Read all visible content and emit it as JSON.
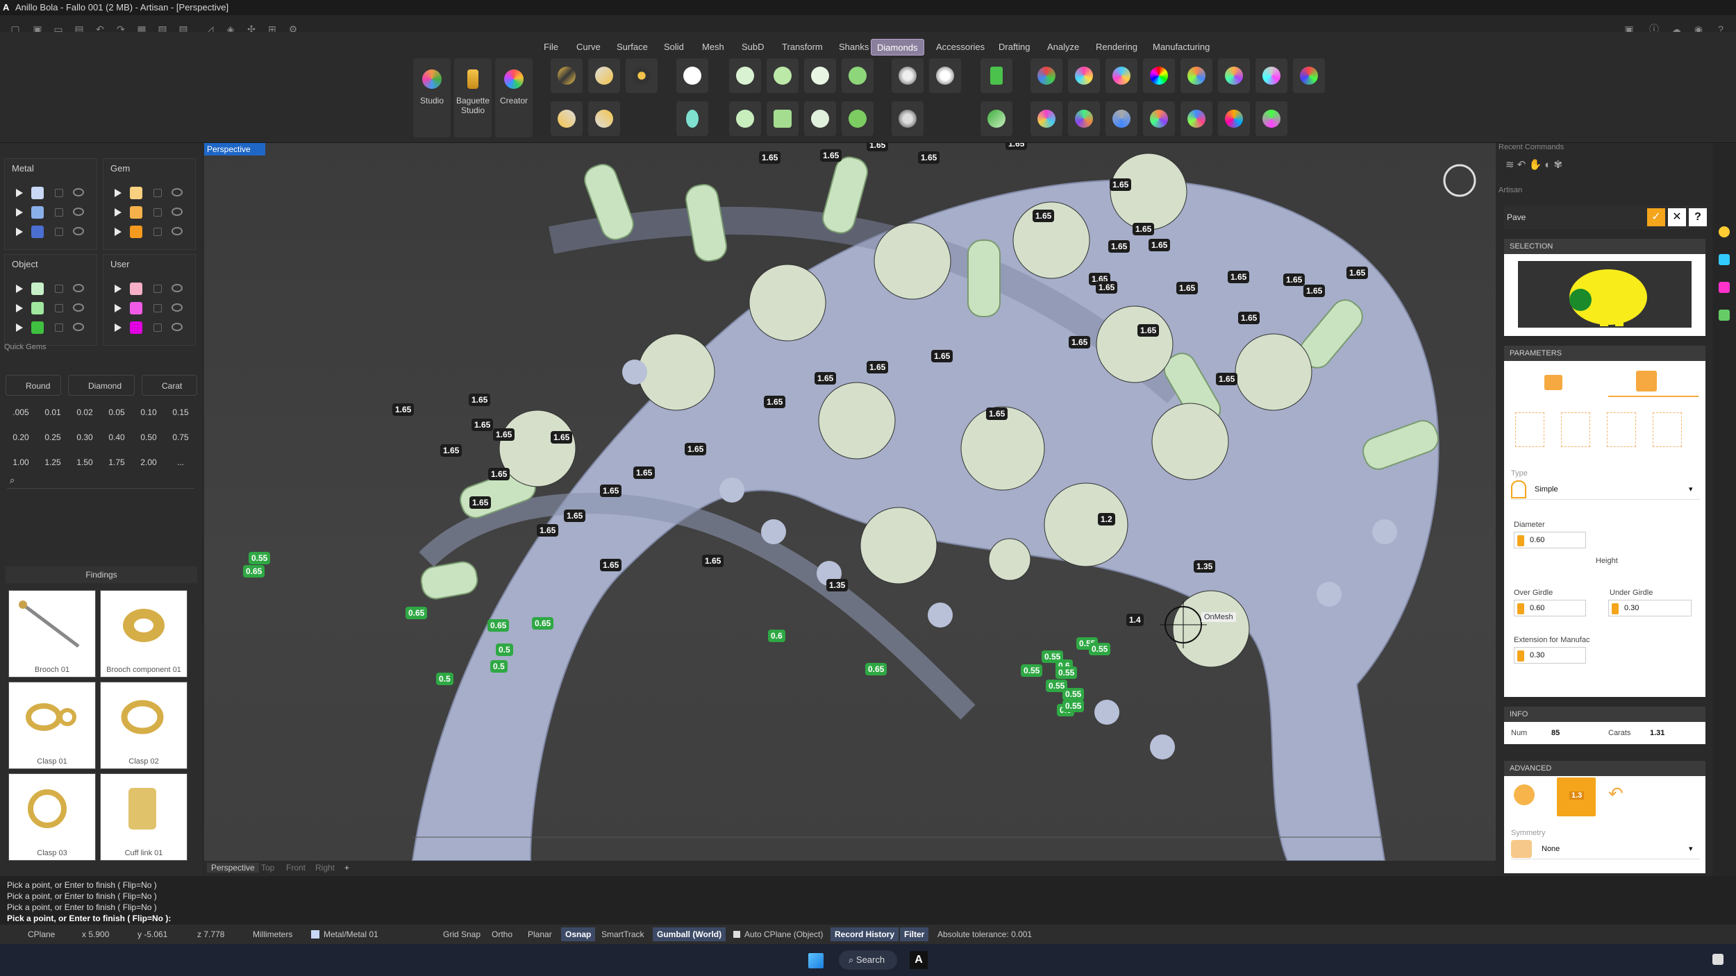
{
  "window": {
    "title": "Anillo Bola - Fallo 001 (2 MB) - Artisan - [Perspective]"
  },
  "menus": [
    "File",
    "Curve",
    "Surface",
    "Solid",
    "Mesh",
    "SubD",
    "Transform",
    "Shanks",
    "Diamonds",
    "Accessories",
    "Drafting",
    "Analyze",
    "Rendering",
    "Manufacturing"
  ],
  "active_menu": "Diamonds",
  "big_tools": [
    {
      "label": "Studio"
    },
    {
      "label": "Baguette Studio"
    },
    {
      "label": "Creator"
    }
  ],
  "layers": {
    "metal": {
      "title": "Metal",
      "colors": [
        "#c8d7f5",
        "#8ab0ea",
        "#4a6fd1"
      ]
    },
    "gem": {
      "title": "Gem",
      "colors": [
        "#f8d080",
        "#f6b14a",
        "#f49a1f"
      ]
    },
    "object": {
      "title": "Object",
      "colors": [
        "#c8f0c8",
        "#a0e8a0",
        "#40c040"
      ]
    },
    "user": {
      "title": "User",
      "colors": [
        "#f7b0c8",
        "#f05ae6",
        "#e000e0"
      ]
    }
  },
  "quick_gems": {
    "title": "Quick Gems",
    "buttons": [
      "Round",
      "Diamond",
      "Carat"
    ],
    "carats": [
      ".005",
      "0.01",
      "0.02",
      "0.05",
      "0.10",
      "0.15",
      "0.20",
      "0.25",
      "0.30",
      "0.40",
      "0.50",
      "0.75",
      "1.00",
      "1.25",
      "1.50",
      "1.75",
      "2.00",
      "..."
    ]
  },
  "findings": {
    "title": "Findings",
    "items": [
      "Brooch 01",
      "Brooch component 01",
      "Clasp 01",
      "Clasp 02",
      "Clasp 03",
      "Cuff link 01"
    ]
  },
  "viewport": {
    "tab": "Perspective",
    "bottom_tabs": [
      "Perspective",
      "Top",
      "Front",
      "Right",
      "+"
    ],
    "osnap_label": "OnMesh",
    "labels_black": [
      "1.65",
      "1.65",
      "1.65",
      "1.65",
      "1.65",
      "1.65",
      "1.65",
      "1.65",
      "1.65",
      "1.65",
      "1.65",
      "1.65",
      "1.65",
      "1.65",
      "1.65",
      "1.65",
      "1.65",
      "1.65",
      "1.65",
      "1.65",
      "1.65",
      "1.65",
      "1.65",
      "1.65",
      "1.65",
      "1.65",
      "1.65",
      "1.65",
      "1.65",
      "1.65",
      "1.65",
      "1.65",
      "1.65",
      "1.65",
      "1.65",
      "1.65",
      "1.65",
      "1.65",
      "1.65",
      "1.65",
      "1.65",
      "1.65",
      "1.65",
      "1.65",
      "1.65",
      "1.65",
      "1.65",
      "1.65",
      "1.65",
      "1.65",
      "1.65",
      "1.65",
      "1.35",
      "1.2",
      "1.4",
      "1.35"
    ],
    "labels_green": [
      "0.55",
      "0.65",
      "0.65",
      "0.65",
      "0.65",
      "0.5",
      "0.5",
      "0.5",
      "0.6",
      "0.65",
      "0.55",
      "0.55",
      "0.6",
      "0.55",
      "0.55",
      "0.55",
      "0.55",
      "0.55",
      "0.6",
      "0.55"
    ]
  },
  "right": {
    "recent_commands": "Recent Commands",
    "artisan": "Artisan",
    "command": "Pave",
    "selection": "SELECTION",
    "parameters": "PARAMETERS",
    "type_label": "Type",
    "type_value": "Simple",
    "diameter_label": "Diameter",
    "diameter_value": "0.60",
    "height_label": "Height",
    "over_girdle_label": "Over Girdle",
    "over_girdle_value": "0.60",
    "under_girdle_label": "Under Girdle",
    "under_girdle_value": "0.30",
    "extension_label": "Extension for Manufac",
    "extension_value": "0.30",
    "info": "INFO",
    "num_label": "Num",
    "num_value": "85",
    "carats_label": "Carats",
    "carats_value": "1.31",
    "advanced": "ADVANCED",
    "adv_badge": "1.3",
    "symmetry_label": "Symmetry",
    "symmetry_value": "None"
  },
  "command_history": [
    "Pick a point, or Enter to finish ( Flip=No )",
    "Pick a point, or Enter to finish ( Flip=No )",
    "Pick a point, or Enter to finish ( Flip=No )",
    "Pick a point, or Enter to finish ( Flip=No )"
  ],
  "command_prompt": "Pick a point, or Enter to finish ( Flip=No ):",
  "status": {
    "cplane": "CPlane",
    "x": "x 5.900",
    "y": "y -5.061",
    "z": "z 7.778",
    "units": "Millimeters",
    "layer": "Metal/Metal 01",
    "grid_snap": "Grid Snap",
    "ortho": "Ortho",
    "planar": "Planar",
    "osnap": "Osnap",
    "smarttrack": "SmartTrack",
    "gumball": "Gumball (World)",
    "auto_cplane": "Auto CPlane (Object)",
    "record_history": "Record History",
    "filter": "Filter",
    "tolerance": "Absolute tolerance: 0.001"
  },
  "taskbar": {
    "search": "Search"
  }
}
